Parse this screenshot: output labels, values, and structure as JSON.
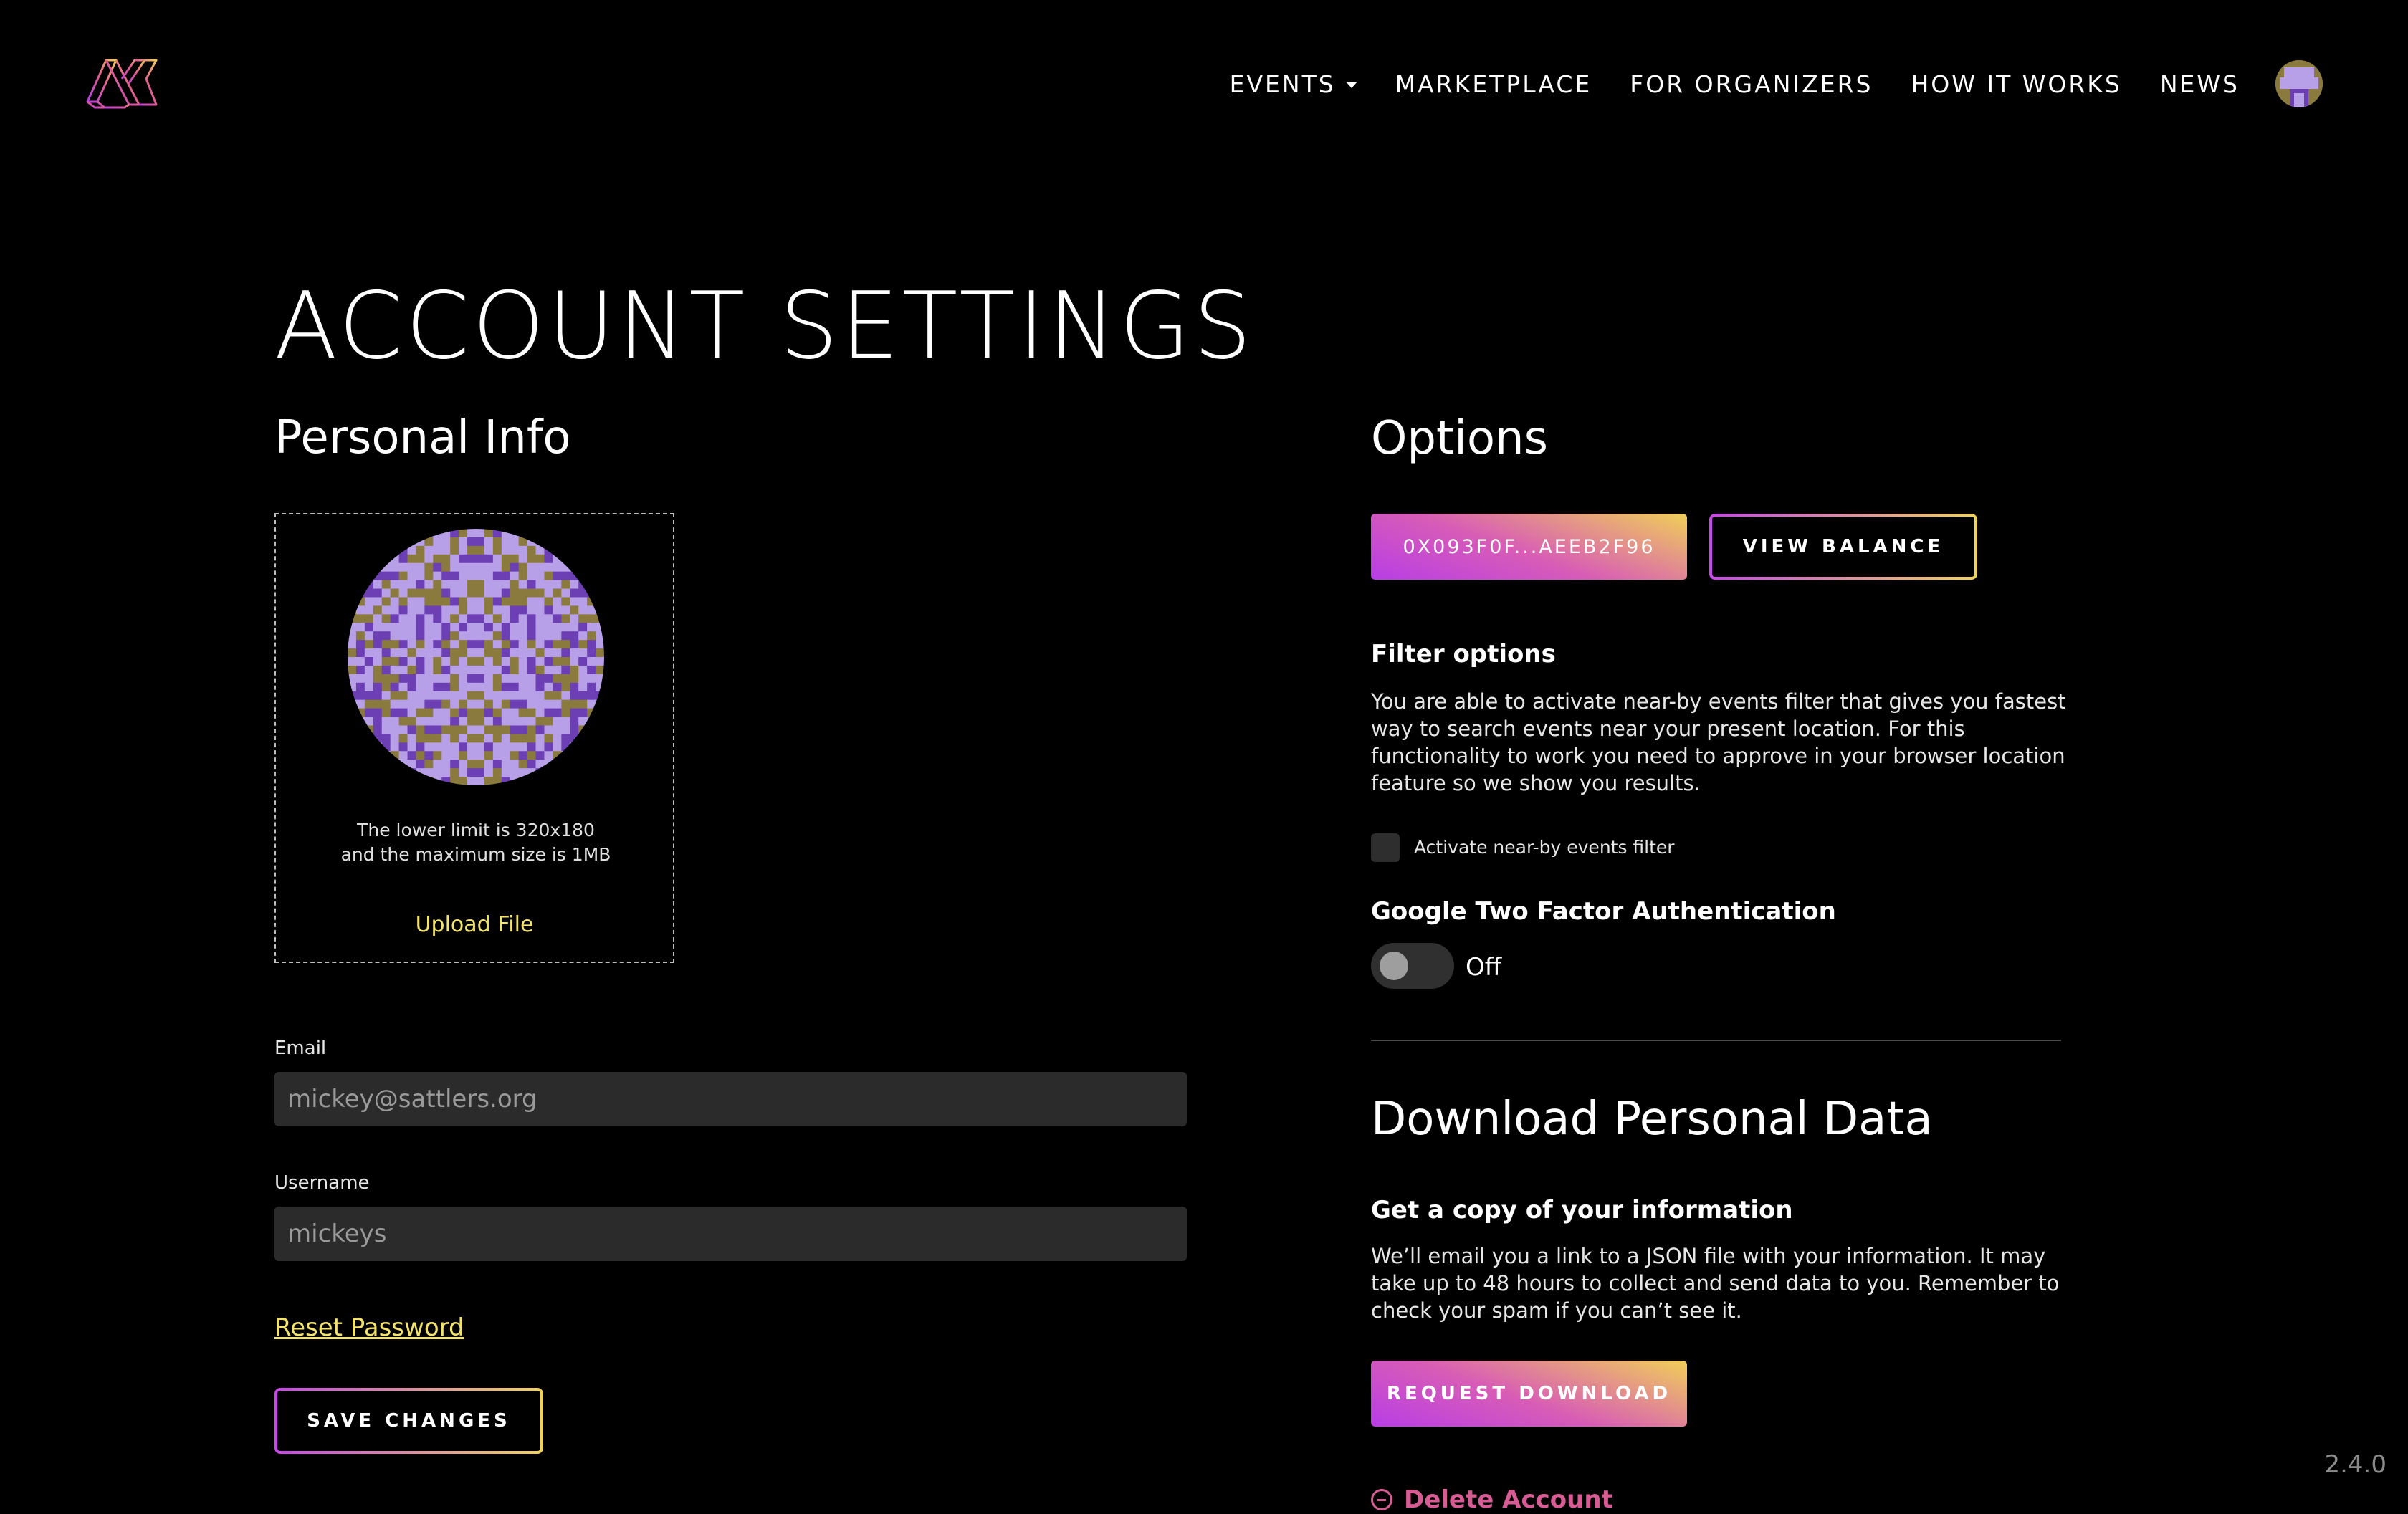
{
  "header": {
    "logo_icon": "brand-logo-icon",
    "nav": [
      {
        "label": "EVENTS",
        "has_dropdown": true
      },
      {
        "label": "MARKETPLACE"
      },
      {
        "label": "FOR ORGANIZERS"
      },
      {
        "label": "HOW IT WORKS"
      },
      {
        "label": "NEWS"
      }
    ],
    "avatar_icon": "user-avatar"
  },
  "page": {
    "title": "ACCOUNT SETTINGS"
  },
  "personal_info": {
    "title": "Personal Info",
    "upload": {
      "hint": "The lower limit is 320x180 and the maximum size is 1MB",
      "link": "Upload File"
    },
    "email": {
      "label": "Email",
      "value": "mickey@sattlers.org"
    },
    "username": {
      "label": "Username",
      "value": "mickeys"
    },
    "reset_password": "Reset Password",
    "save_button": "SAVE CHANGES"
  },
  "options": {
    "title": "Options",
    "wallet_button": "0X093F0F...AEEB2F96",
    "balance_button": "VIEW BALANCE",
    "filter": {
      "title": "Filter options",
      "text": "You are able to activate near-by events filter that gives you fastest way to search events near your present location. For this functionality to work you need to approve in your browser location feature so we show you results.",
      "checkbox_label": "Activate near-by events filter",
      "checked": false
    },
    "two_factor": {
      "title": "Google Two Factor Authentication",
      "state": "Off"
    }
  },
  "download": {
    "title": "Download Personal Data",
    "subtitle": "Get a copy of your information",
    "text": "We’ll email you a link to a JSON file with your information. It may take up to 48 hours to collect and send data to you. Remember to check your spam if you can’t see it.",
    "button": "REQUEST DOWNLOAD",
    "delete": "Delete Account"
  },
  "version": "2.4.0",
  "colors": {
    "accent_yellow": "#f3e36b",
    "gradient_start": "#b83ee6",
    "gradient_end": "#f0cf58",
    "danger": "#d85c94"
  }
}
